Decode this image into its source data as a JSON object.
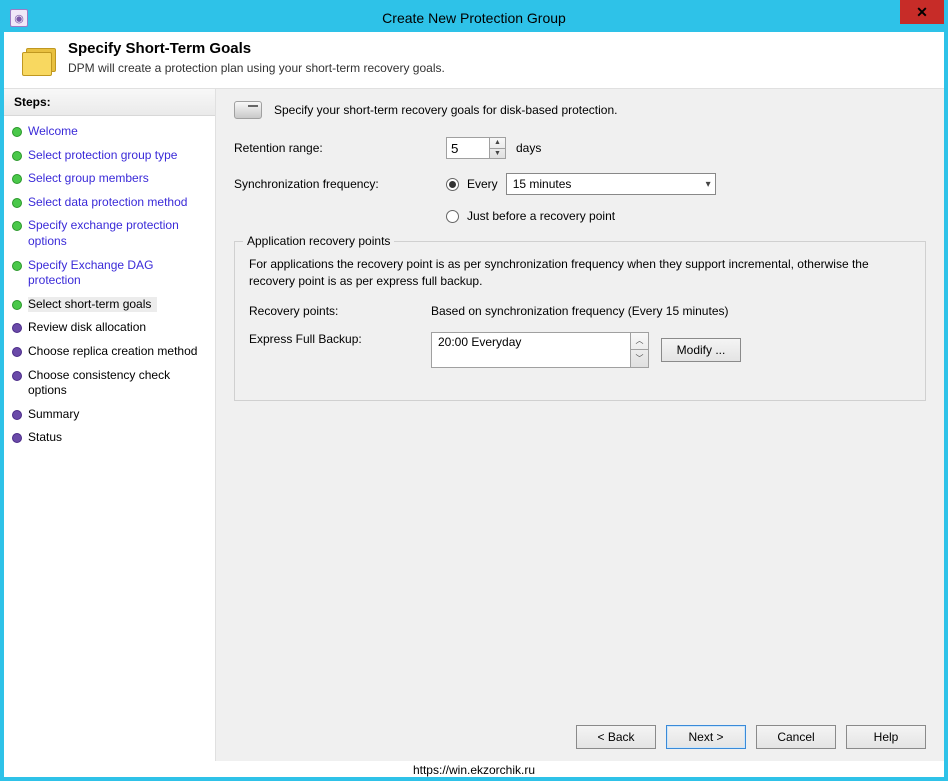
{
  "window": {
    "title": "Create New Protection Group"
  },
  "header": {
    "title": "Specify Short-Term Goals",
    "subtitle": "DPM will create a protection plan using your short-term recovery goals."
  },
  "sidebar": {
    "heading": "Steps:",
    "items": [
      {
        "label": "Welcome",
        "state": "done"
      },
      {
        "label": "Select protection group type",
        "state": "done"
      },
      {
        "label": "Select group members",
        "state": "done"
      },
      {
        "label": "Select data protection method",
        "state": "done"
      },
      {
        "label": "Specify exchange protection options",
        "state": "done"
      },
      {
        "label": "Specify Exchange DAG protection",
        "state": "done"
      },
      {
        "label": "Select short-term goals",
        "state": "active"
      },
      {
        "label": "Review disk allocation",
        "state": "todo"
      },
      {
        "label": "Choose replica creation method",
        "state": "todo"
      },
      {
        "label": "Choose consistency check options",
        "state": "todo"
      },
      {
        "label": "Summary",
        "state": "todo"
      },
      {
        "label": "Status",
        "state": "todo"
      }
    ]
  },
  "main": {
    "intro": "Specify your short-term recovery goals for disk-based protection.",
    "retention": {
      "label": "Retention range:",
      "value": "5",
      "unit": "days"
    },
    "sync": {
      "label": "Synchronization frequency:",
      "option_every": "Every",
      "interval": "15 minutes",
      "option_before": "Just before a recovery point",
      "selected": "every"
    },
    "grp": {
      "title": "Application recovery points",
      "desc": "For applications the recovery point is as per synchronization frequency when they support incremental, otherwise the recovery point is as per express full backup.",
      "rp_label": "Recovery points:",
      "rp_value": "Based on synchronization frequency (Every 15 minutes)",
      "efb_label": "Express Full Backup:",
      "efb_value": "20:00 Everyday",
      "modify": "Modify ..."
    }
  },
  "footer": {
    "back": "< Back",
    "next": "Next >",
    "cancel": "Cancel",
    "help": "Help"
  },
  "url": "https://win.ekzorchik.ru"
}
